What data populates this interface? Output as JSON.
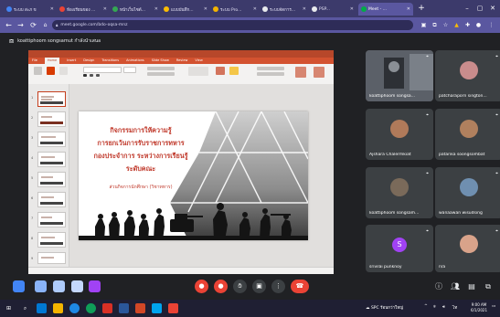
{
  "browser": {
    "tabs": [
      {
        "label": "ระบบ สะภ ข",
        "favicon": "#4285f4",
        "active": false
      },
      {
        "label": "ห้องเรียนของ ...",
        "favicon": "#ea4335",
        "active": false
      },
      {
        "label": "หน้าเว็บไซต์...",
        "favicon": "#34a853",
        "active": false
      },
      {
        "label": "แบบบันทึก...",
        "favicon": "#fbbc04",
        "active": false
      },
      {
        "label": "ระบบ Pro...",
        "favicon": "#f4b400",
        "active": false
      },
      {
        "label": "ระบบจัดการ...",
        "favicon": "#e8eaed",
        "active": false
      },
      {
        "label": "PSP...",
        "favicon": "#e8eaed",
        "active": false
      },
      {
        "label": "Meet - ...",
        "favicon": "#00ac47",
        "active": true
      }
    ],
    "new_tab": "+",
    "url": "meet.google.com/bdo-oqsa-mnz"
  },
  "meeting": {
    "presenter_label": "koattiphoom songsamut กำลังนำเสนอ"
  },
  "powerpoint": {
    "ribbon_tabs": [
      "File",
      "Home",
      "Insert",
      "Design",
      "Transitions",
      "Animations",
      "Slide Show",
      "Review",
      "View"
    ],
    "selected_tab": "Home",
    "thumb_numbers": [
      "1",
      "2",
      "3",
      "4",
      "5",
      "6",
      "7",
      "8",
      "9"
    ],
    "slide": {
      "title_lines": [
        "กิจกรรมการให้ความรู้",
        "การยกเว้นการรับราชการทหาร",
        "กองประจำการ ระหว่างการเรียนรู้",
        "ระดับคณะ"
      ],
      "subtitle": "ส่วนกิจการนักศึกษา (วิชาทหาร)"
    }
  },
  "participants": [
    {
      "name": "koattiphoom songsa...",
      "type": "photo",
      "bg": "#4a4f55",
      "face": "#8a8f95"
    },
    {
      "name": "patcharaporn sington...",
      "type": "photo",
      "bg": "#3c4043",
      "face": "#c98c8c"
    },
    {
      "name": "Ajshara Chalermkiat",
      "type": "photo",
      "bg": "#3c4043",
      "face": "#b07a5a"
    },
    {
      "name": "patarika soongsombat",
      "type": "photo",
      "bg": "#3c4043",
      "face": "#b0805e"
    },
    {
      "name": "koattiphoom songsam...",
      "type": "photo",
      "bg": "#3c4043",
      "face": "#7a6a5a"
    },
    {
      "name": "wanaawan wisudsing",
      "type": "photo",
      "bg": "#3c4043",
      "face": "#6f8fb0"
    },
    {
      "name": "srivilai punknoy",
      "type": "initial",
      "initial": "S",
      "bg": "#3c4043"
    },
    {
      "name": "n/a",
      "type": "photo",
      "bg": "#3c4043",
      "face": "#d9a38a"
    }
  ],
  "taskbar": {
    "tray_text": "SPC ร้อนกว่าใหญ่",
    "lang": "ไท",
    "time": "9:00 AM",
    "date": "6/1/2021"
  }
}
